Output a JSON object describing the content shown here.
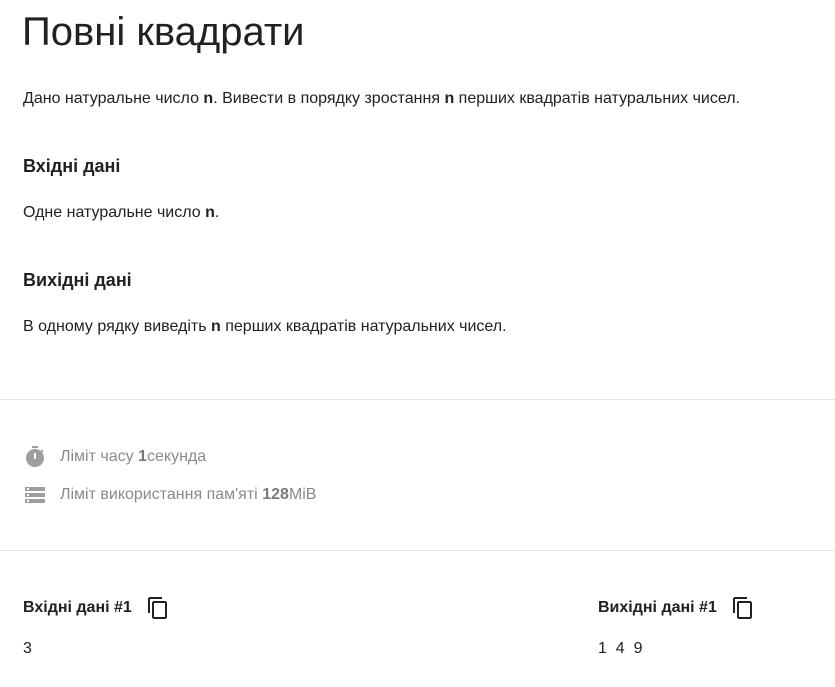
{
  "problem": {
    "title": "Повні квадрати",
    "statement": {
      "pre": "Дано натуральне число ",
      "var1": "n",
      "mid": ". Вивести в порядку зростання ",
      "var2": "n",
      "post": " перших квадратів натуральних чисел."
    },
    "input_section": {
      "heading": "Вхідні дані",
      "pre": "Одне натуральне число ",
      "var": "n",
      "post": "."
    },
    "output_section": {
      "heading": "Вихідні дані",
      "pre": "В одному рядку виведіть ",
      "var": "n",
      "post": " перших квадратів натуральних чисел."
    }
  },
  "limits": {
    "time": {
      "icon": "stopwatch-icon",
      "pre": "Ліміт часу ",
      "value": "1",
      "post": " секунда"
    },
    "memory": {
      "icon": "memory-icon",
      "pre": "Ліміт використання пам'яті ",
      "value": "128",
      "post": " MiB"
    }
  },
  "samples": {
    "input": {
      "label": "Вхідні дані #1",
      "icon": "copy-icon",
      "value": "3"
    },
    "output": {
      "label": "Вихідні дані #1",
      "icon": "copy-icon",
      "value": "1  4  9"
    }
  },
  "colors": {
    "text": "#202124",
    "muted": "#8a8a8a",
    "divider": "#e3e3e3",
    "icon": "#9e9e9e"
  }
}
